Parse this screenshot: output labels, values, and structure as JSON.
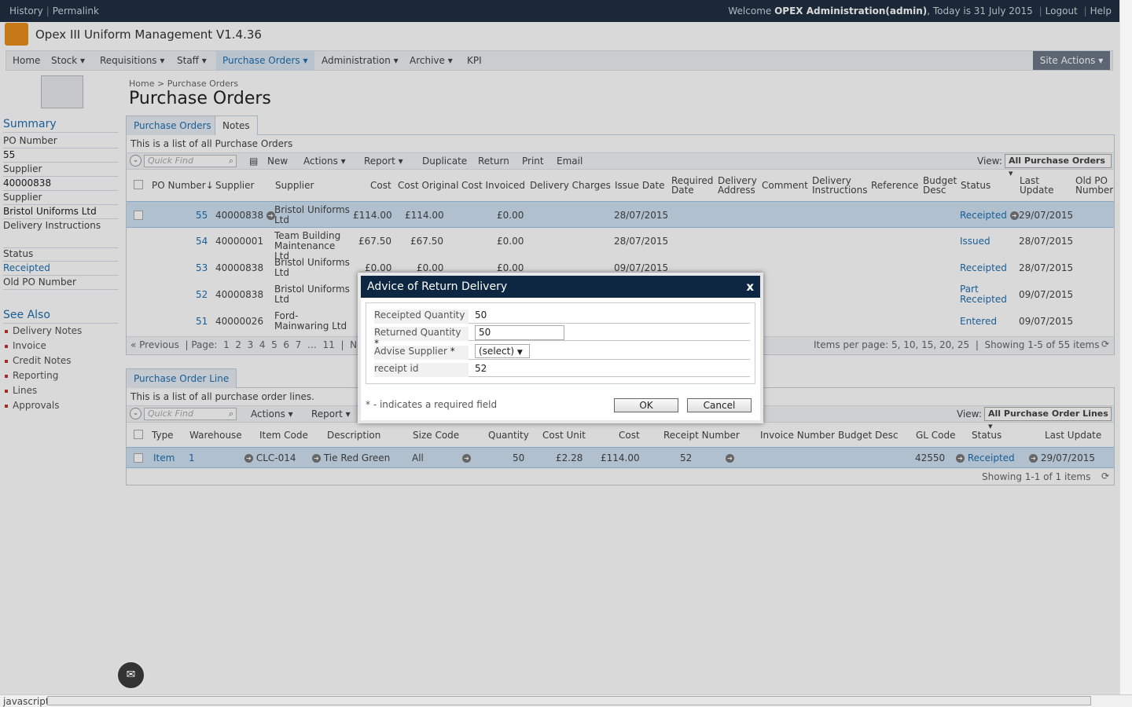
{
  "topbar": {
    "history": "History",
    "permalink": "Permalink",
    "welcome_prefix": "Welcome",
    "user": "OPEX Administration(admin)",
    "date_text": ", Today is 31 July 2015",
    "logout": "Logout",
    "help": "Help"
  },
  "app": {
    "title": "Opex III Uniform Management V1.4.36"
  },
  "nav": {
    "items": [
      "Home",
      "Stock ▾",
      "Requisitions ▾",
      "Staff ▾",
      "Purchase Orders ▾",
      "Administration ▾",
      "Archive ▾",
      "KPI"
    ],
    "site_actions": "Site Actions ▾"
  },
  "left": {
    "summary": "Summary",
    "rows": [
      "PO Number",
      "55",
      "Supplier",
      "40000838",
      "Supplier",
      "Bristol Uniforms Ltd",
      "Delivery Instructions",
      "",
      "Status",
      "Receipted",
      "Old PO Number"
    ],
    "see_also": "See Also",
    "links": [
      "Delivery Notes",
      "Invoice",
      "Credit Notes",
      "Reporting",
      "Lines",
      "Approvals"
    ]
  },
  "page": {
    "breadcrumb": "Home  >  Purchase Orders",
    "title": "Purchase Orders"
  },
  "po": {
    "tabs": [
      "Purchase Orders",
      "Notes"
    ],
    "desc": "This is a list of all Purchase Orders",
    "quickfind": "Quick Find",
    "actions": [
      "New",
      "Actions ▾",
      "Report ▾",
      "Duplicate",
      "Return",
      "Print",
      "Email"
    ],
    "view_label": "View:",
    "view_value": "All Purchase Orders",
    "headers": [
      "PO Number↓",
      "Supplier",
      "Supplier",
      "Cost",
      "Cost Original",
      "Cost Invoiced",
      "Delivery Charges",
      "Issue Date",
      "Required Date",
      "Delivery Address",
      "Comment",
      "Delivery Instructions",
      "Reference",
      "Budget Desc",
      "Status",
      "Last Update",
      "Old PO Number"
    ],
    "rows": [
      {
        "po": "55",
        "sup": "40000838",
        "name": "Bristol Uniforms Ltd",
        "cost": "£114.00",
        "orig": "£114.00",
        "inv": "£0.00",
        "issue": "28/07/2015",
        "status": "Receipted",
        "updated": "29/07/2015"
      },
      {
        "po": "54",
        "sup": "40000001",
        "name": "Team Building Maintenance Ltd",
        "cost": "£67.50",
        "orig": "£67.50",
        "inv": "£0.00",
        "issue": "28/07/2015",
        "status": "Issued",
        "updated": "28/07/2015"
      },
      {
        "po": "53",
        "sup": "40000838",
        "name": "Bristol Uniforms Ltd",
        "cost": "£0.00",
        "orig": "£0.00",
        "inv": "£0.00",
        "issue": "09/07/2015",
        "status": "Receipted",
        "updated": "28/07/2015"
      },
      {
        "po": "52",
        "sup": "40000838",
        "name": "Bristol Uniforms Ltd",
        "cost": "",
        "orig": "",
        "inv": "",
        "issue": "",
        "status": "Part Receipted",
        "updated": "09/07/2015"
      },
      {
        "po": "51",
        "sup": "40000026",
        "name": "Ford-Mainwaring Ltd",
        "cost": "",
        "orig": "",
        "inv": "",
        "issue": "",
        "status": "Entered",
        "updated": "09/07/2015"
      }
    ],
    "pager": "« Previous  | Page:  1  2  3  4  5  6  7  …  11  |  Next",
    "items_per_page": "Items per page: 5, 10, 15, 20, 25  |  Showing 1-5 of 55 items"
  },
  "pol": {
    "tab": "Purchase Order Line",
    "desc": "This is a list of all purchase order lines.",
    "quickfind": "Quick Find",
    "actions": [
      "Actions ▾",
      "Report ▾"
    ],
    "view_label": "View:",
    "view_value": "All Purchase Order Lines",
    "headers": [
      "Type",
      "Warehouse",
      "Item Code",
      "Description",
      "Size Code",
      "Quantity",
      "Cost Unit",
      "Cost",
      "Receipt Number",
      "Invoice Number",
      "Budget Desc",
      "GL Code",
      "Status",
      "Last Update"
    ],
    "row": {
      "type": "Item",
      "warehouse": "1",
      "code": "CLC-014",
      "desc": "Tie Red Green",
      "size": "All",
      "qty": "50",
      "unit": "£2.28",
      "cost": "£114.00",
      "receipt": "52",
      "gl": "42550",
      "status": "Receipted",
      "updated": "29/07/2015"
    },
    "showing": "Showing 1-1 of 1 items"
  },
  "dialog": {
    "title": "Advice of Return Delivery",
    "close": "x",
    "receipted_label": "Receipted Quantity",
    "receipted_value": "50",
    "returned_label": "Returned Quantity",
    "returned_value": "50",
    "advise_label": "Advise Supplier",
    "advise_value": "(select)",
    "receipt_label": "receipt id",
    "receipt_value": "52",
    "required_note": "* - indicates a required field",
    "ok": "OK",
    "cancel": "Cancel"
  },
  "statusbar": {
    "text": "javascript:"
  }
}
